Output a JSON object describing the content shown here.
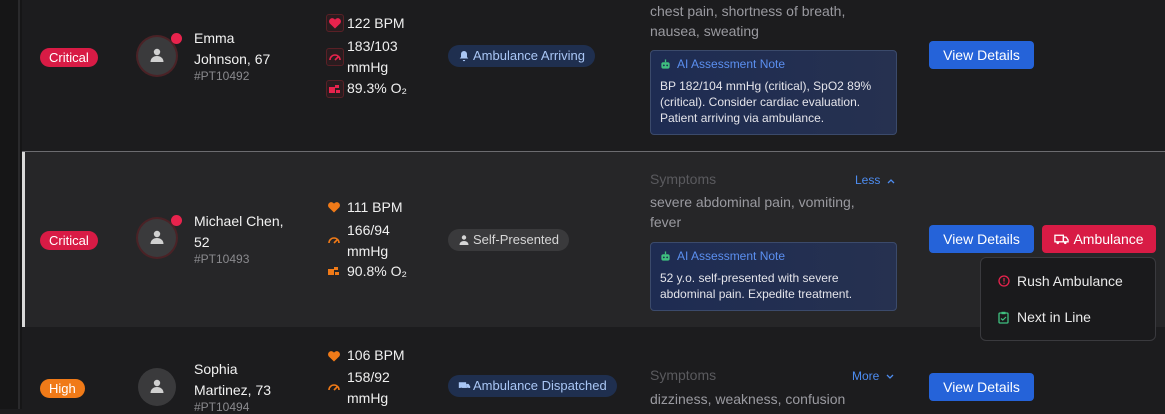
{
  "colors": {
    "critical": "#d81b45",
    "high": "#f07a18",
    "primary": "#2563d9",
    "ai_title": "#5b8ff0"
  },
  "rows": [
    {
      "severity": "Critical",
      "name": "Emma Johnson, 67",
      "name_line1": "Emma",
      "name_line2": "Johnson, 67",
      "id": "#PT10492",
      "hr": "122 BPM",
      "bp_line1": "183/103",
      "bp_line2": "mmHg",
      "spo2": "89.3% O₂",
      "status": "Ambulance Arriving",
      "symptoms_line1": "chest pain, shortness of breath,",
      "symptoms_line2": "nausea, sweating",
      "ai_title": "AI Assessment Note",
      "ai_note": "BP 182/104 mmHg (critical), SpO2 89% (critical). Consider cardiac evaluation. Patient arriving via ambulance.",
      "view_label": "View Details"
    },
    {
      "severity": "Critical",
      "name_line1": "Michael Chen,",
      "name_line2": "52",
      "id": "#PT10493",
      "hr": "111 BPM",
      "bp_line1": "166/94",
      "bp_line2": "mmHg",
      "spo2": "90.8% O₂",
      "status": "Self-Presented",
      "symptoms_label": "Symptoms",
      "toggle": "Less",
      "symptoms_line1": "severe abdominal pain, vomiting,",
      "symptoms_line2": "fever",
      "ai_title": "AI Assessment Note",
      "ai_note": "52 y.o. self-presented with severe abdominal pain. Expedite treatment.",
      "view_label": "View Details",
      "ambulance_label": "Ambulance",
      "menu": {
        "rush": "Rush Ambulance",
        "next": "Next in Line"
      }
    },
    {
      "severity": "High",
      "name_line1": "Sophia",
      "name_line2": "Martinez, 73",
      "id": "#PT10494",
      "hr": "106 BPM",
      "bp_line1": "158/92",
      "bp_line2": "mmHg",
      "status": "Ambulance Dispatched",
      "symptoms_label": "Symptoms",
      "toggle": "More",
      "symptoms_line1": "dizziness, weakness, confusion",
      "view_label": "View Details"
    }
  ]
}
